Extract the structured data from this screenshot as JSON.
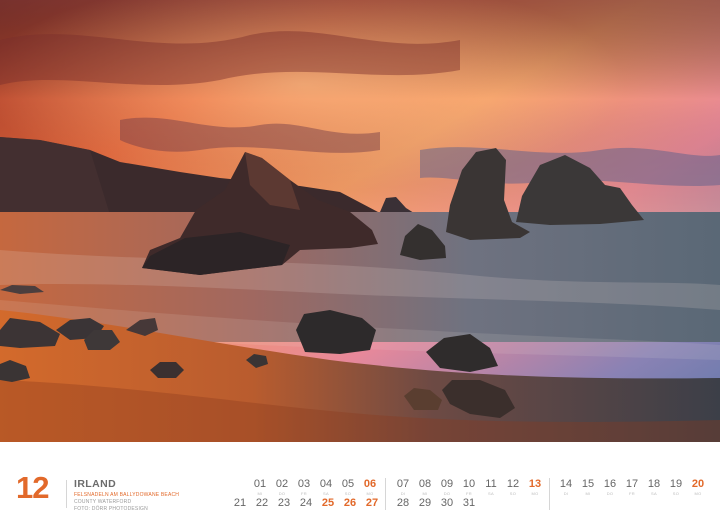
{
  "month": {
    "number": "12",
    "country": "IRLAND",
    "location_line1": "FELSNADELN AM BALLYDOWANE BEACH",
    "location_line2": "COUNTY WATERFORD",
    "credit": "FOTO: DÖRR PHOTODESIGN"
  },
  "weekday_labels": [
    "MO",
    "DI",
    "MI",
    "DO",
    "FR",
    "SA",
    "SO"
  ],
  "row1": [
    {
      "day": "01",
      "sunday": false
    },
    {
      "day": "02",
      "sunday": false
    },
    {
      "day": "03",
      "sunday": false
    },
    {
      "day": "04",
      "sunday": false
    },
    {
      "day": "05",
      "sunday": false
    },
    {
      "day": "06",
      "sunday": true
    },
    {
      "day": "07",
      "sunday": false
    },
    {
      "day": "08",
      "sunday": false
    },
    {
      "day": "09",
      "sunday": false
    },
    {
      "day": "10",
      "sunday": false
    },
    {
      "day": "11",
      "sunday": false
    },
    {
      "day": "12",
      "sunday": false
    },
    {
      "day": "13",
      "sunday": true
    },
    {
      "day": "14",
      "sunday": false
    },
    {
      "day": "15",
      "sunday": false
    },
    {
      "day": "16",
      "sunday": false
    },
    {
      "day": "17",
      "sunday": false
    },
    {
      "day": "18",
      "sunday": false
    },
    {
      "day": "19",
      "sunday": false
    },
    {
      "day": "20",
      "sunday": true
    }
  ],
  "row2": [
    {
      "day": "21",
      "sunday": false
    },
    {
      "day": "22",
      "sunday": false
    },
    {
      "day": "23",
      "sunday": false
    },
    {
      "day": "24",
      "sunday": false
    },
    {
      "day": "25",
      "sunday": true
    },
    {
      "day": "26",
      "sunday": true
    },
    {
      "day": "27",
      "sunday": true
    },
    {
      "day": "28",
      "sunday": false
    },
    {
      "day": "29",
      "sunday": false
    },
    {
      "day": "30",
      "sunday": false
    },
    {
      "day": "31",
      "sunday": false
    }
  ],
  "colors": {
    "accent": "#e2692a",
    "day_text": "#666666"
  }
}
